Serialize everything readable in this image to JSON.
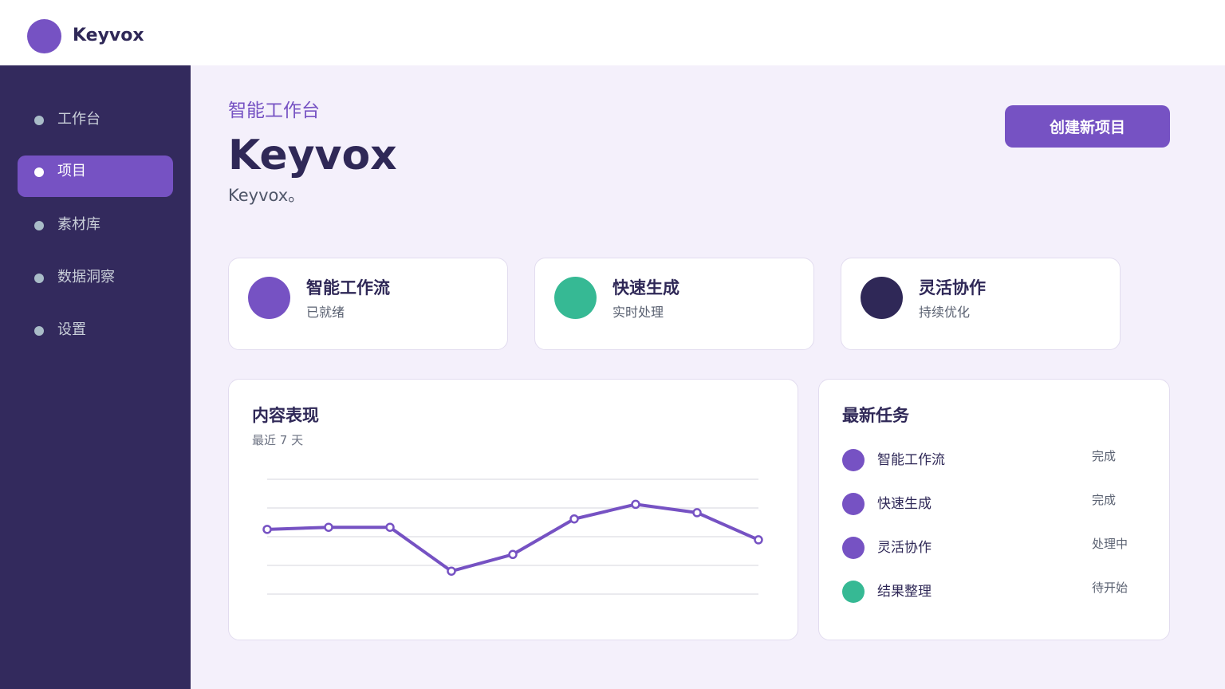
{
  "brand": {
    "name": "Keyvox"
  },
  "sidebar": {
    "items": [
      {
        "label": "工作台",
        "active": false
      },
      {
        "label": "项目",
        "active": true
      },
      {
        "label": "素材库",
        "active": false
      },
      {
        "label": "数据洞察",
        "active": false
      },
      {
        "label": "设置",
        "active": false
      }
    ]
  },
  "header": {
    "eyebrow": "智能工作台",
    "title": "Keyvox",
    "subtitle": "Keyvox。",
    "create_button": "创建新项目"
  },
  "stats": [
    {
      "title": "智能工作流",
      "subtitle": "已就绪",
      "color": "#7652c3"
    },
    {
      "title": "快速生成",
      "subtitle": "实时处理",
      "color": "#36b994"
    },
    {
      "title": "灵活协作",
      "subtitle": "持续优化",
      "color": "#2f2857"
    }
  ],
  "performance": {
    "title": "内容表现",
    "subtitle": "最近 7 天"
  },
  "chart_data": {
    "type": "line",
    "x": [
      1,
      2,
      3,
      4,
      5,
      6,
      7,
      8,
      9
    ],
    "values": [
      61,
      62,
      62,
      41,
      49,
      66,
      73,
      69,
      56
    ],
    "ylim": [
      30,
      85
    ],
    "grid": true,
    "color": "#7652c3"
  },
  "tasks": {
    "title": "最新任务",
    "items": [
      {
        "name": "智能工作流",
        "status": "完成",
        "color": "#7652c3"
      },
      {
        "name": "快速生成",
        "status": "完成",
        "color": "#7652c3"
      },
      {
        "name": "灵活协作",
        "status": "处理中",
        "color": "#7652c3"
      },
      {
        "name": "结果整理",
        "status": "待开始",
        "color": "#36b994"
      }
    ]
  },
  "colors": {
    "accent": "#7652c3",
    "success": "#36b994",
    "sidebar": "#332a5d",
    "background": "#f4f0fb"
  }
}
